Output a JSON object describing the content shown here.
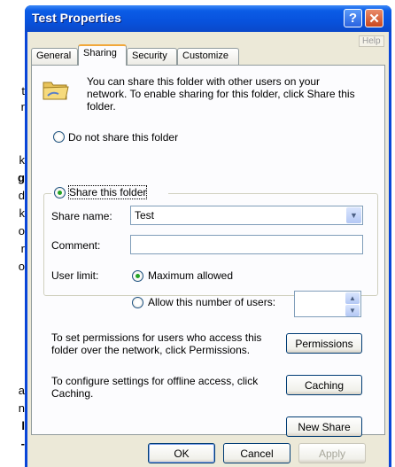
{
  "background_text": [
    "t",
    "r",
    "k",
    "g",
    "d",
    "k",
    "o",
    "r",
    "o",
    "a",
    "n",
    "l",
    "-"
  ],
  "window": {
    "title": "Test Properties",
    "help_button": "?",
    "close_button": "✕",
    "help_link": "Help"
  },
  "tabs": [
    {
      "label": "General",
      "active": false
    },
    {
      "label": "Sharing",
      "active": true
    },
    {
      "label": "Security",
      "active": false
    },
    {
      "label": "Customize",
      "active": false
    }
  ],
  "sharing": {
    "intro_line1": "You can share this folder with other users on your",
    "intro_line2": "network.  To enable sharing for this folder, click Share this",
    "intro_line3": "folder.",
    "do_not_share": "Do not share this folder",
    "share_this": "Share this folder",
    "share_name_label": "Share name:",
    "share_name_value": "Test",
    "comment_label": "Comment:",
    "comment_value": "",
    "user_limit_label": "User limit:",
    "max_allowed": "Maximum allowed",
    "allow_this_number": "Allow this number of users:",
    "user_count_value": "",
    "permissions_text_line1": "To set permissions for users who access this",
    "permissions_text_line2": "folder over the network, click Permissions.",
    "permissions_button": "Permissions",
    "caching_text_line1": "To configure settings for offline access, click",
    "caching_text_line2": "Caching.",
    "caching_button": "Caching",
    "new_share_button": "New Share"
  },
  "footer": {
    "ok": "OK",
    "cancel": "Cancel",
    "apply": "Apply"
  }
}
